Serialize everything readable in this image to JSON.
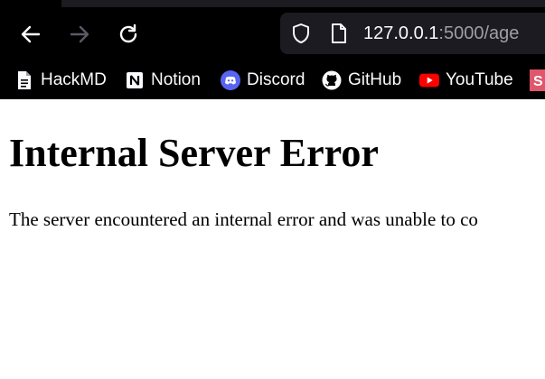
{
  "browser": {
    "url_host": "127.0.0.1",
    "url_path": ":5000/age",
    "bookmarks": [
      {
        "label": "HackMD",
        "icon": "hackmd-icon"
      },
      {
        "label": "Notion",
        "icon": "notion-icon"
      },
      {
        "label": "Discord",
        "icon": "discord-icon"
      },
      {
        "label": "GitHub",
        "icon": "github-icon"
      },
      {
        "label": "YouTube",
        "icon": "youtube-icon"
      }
    ]
  },
  "page": {
    "heading": "Internal Server Error",
    "message": "The server encountered an internal error and was unable to co"
  },
  "colors": {
    "chrome_bg": "#000000",
    "urlbar_bg": "#1c1b22",
    "discord": "#5865f2",
    "youtube": "#ff0000",
    "partial_bookmark": "#e0566b"
  }
}
